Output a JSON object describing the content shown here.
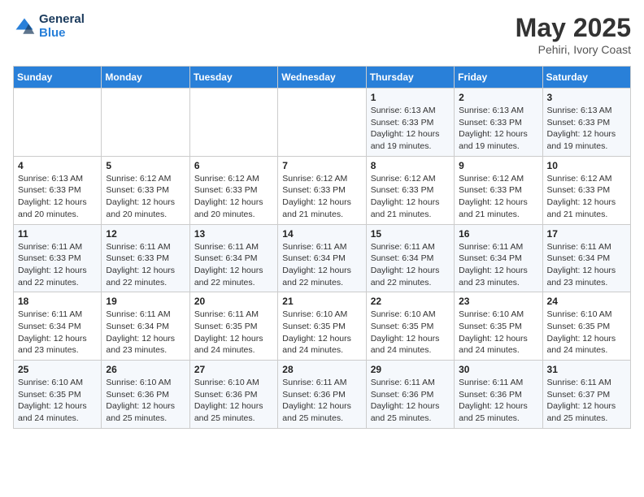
{
  "header": {
    "logo_line1": "General",
    "logo_line2": "Blue",
    "month": "May 2025",
    "location": "Pehiri, Ivory Coast"
  },
  "days_of_week": [
    "Sunday",
    "Monday",
    "Tuesday",
    "Wednesday",
    "Thursday",
    "Friday",
    "Saturday"
  ],
  "weeks": [
    [
      {
        "day": "",
        "info": ""
      },
      {
        "day": "",
        "info": ""
      },
      {
        "day": "",
        "info": ""
      },
      {
        "day": "",
        "info": ""
      },
      {
        "day": "1",
        "info": "Sunrise: 6:13 AM\nSunset: 6:33 PM\nDaylight: 12 hours\nand 19 minutes."
      },
      {
        "day": "2",
        "info": "Sunrise: 6:13 AM\nSunset: 6:33 PM\nDaylight: 12 hours\nand 19 minutes."
      },
      {
        "day": "3",
        "info": "Sunrise: 6:13 AM\nSunset: 6:33 PM\nDaylight: 12 hours\nand 19 minutes."
      }
    ],
    [
      {
        "day": "4",
        "info": "Sunrise: 6:13 AM\nSunset: 6:33 PM\nDaylight: 12 hours\nand 20 minutes."
      },
      {
        "day": "5",
        "info": "Sunrise: 6:12 AM\nSunset: 6:33 PM\nDaylight: 12 hours\nand 20 minutes."
      },
      {
        "day": "6",
        "info": "Sunrise: 6:12 AM\nSunset: 6:33 PM\nDaylight: 12 hours\nand 20 minutes."
      },
      {
        "day": "7",
        "info": "Sunrise: 6:12 AM\nSunset: 6:33 PM\nDaylight: 12 hours\nand 21 minutes."
      },
      {
        "day": "8",
        "info": "Sunrise: 6:12 AM\nSunset: 6:33 PM\nDaylight: 12 hours\nand 21 minutes."
      },
      {
        "day": "9",
        "info": "Sunrise: 6:12 AM\nSunset: 6:33 PM\nDaylight: 12 hours\nand 21 minutes."
      },
      {
        "day": "10",
        "info": "Sunrise: 6:12 AM\nSunset: 6:33 PM\nDaylight: 12 hours\nand 21 minutes."
      }
    ],
    [
      {
        "day": "11",
        "info": "Sunrise: 6:11 AM\nSunset: 6:33 PM\nDaylight: 12 hours\nand 22 minutes."
      },
      {
        "day": "12",
        "info": "Sunrise: 6:11 AM\nSunset: 6:33 PM\nDaylight: 12 hours\nand 22 minutes."
      },
      {
        "day": "13",
        "info": "Sunrise: 6:11 AM\nSunset: 6:34 PM\nDaylight: 12 hours\nand 22 minutes."
      },
      {
        "day": "14",
        "info": "Sunrise: 6:11 AM\nSunset: 6:34 PM\nDaylight: 12 hours\nand 22 minutes."
      },
      {
        "day": "15",
        "info": "Sunrise: 6:11 AM\nSunset: 6:34 PM\nDaylight: 12 hours\nand 22 minutes."
      },
      {
        "day": "16",
        "info": "Sunrise: 6:11 AM\nSunset: 6:34 PM\nDaylight: 12 hours\nand 23 minutes."
      },
      {
        "day": "17",
        "info": "Sunrise: 6:11 AM\nSunset: 6:34 PM\nDaylight: 12 hours\nand 23 minutes."
      }
    ],
    [
      {
        "day": "18",
        "info": "Sunrise: 6:11 AM\nSunset: 6:34 PM\nDaylight: 12 hours\nand 23 minutes."
      },
      {
        "day": "19",
        "info": "Sunrise: 6:11 AM\nSunset: 6:34 PM\nDaylight: 12 hours\nand 23 minutes."
      },
      {
        "day": "20",
        "info": "Sunrise: 6:11 AM\nSunset: 6:35 PM\nDaylight: 12 hours\nand 24 minutes."
      },
      {
        "day": "21",
        "info": "Sunrise: 6:10 AM\nSunset: 6:35 PM\nDaylight: 12 hours\nand 24 minutes."
      },
      {
        "day": "22",
        "info": "Sunrise: 6:10 AM\nSunset: 6:35 PM\nDaylight: 12 hours\nand 24 minutes."
      },
      {
        "day": "23",
        "info": "Sunrise: 6:10 AM\nSunset: 6:35 PM\nDaylight: 12 hours\nand 24 minutes."
      },
      {
        "day": "24",
        "info": "Sunrise: 6:10 AM\nSunset: 6:35 PM\nDaylight: 12 hours\nand 24 minutes."
      }
    ],
    [
      {
        "day": "25",
        "info": "Sunrise: 6:10 AM\nSunset: 6:35 PM\nDaylight: 12 hours\nand 24 minutes."
      },
      {
        "day": "26",
        "info": "Sunrise: 6:10 AM\nSunset: 6:36 PM\nDaylight: 12 hours\nand 25 minutes."
      },
      {
        "day": "27",
        "info": "Sunrise: 6:10 AM\nSunset: 6:36 PM\nDaylight: 12 hours\nand 25 minutes."
      },
      {
        "day": "28",
        "info": "Sunrise: 6:11 AM\nSunset: 6:36 PM\nDaylight: 12 hours\nand 25 minutes."
      },
      {
        "day": "29",
        "info": "Sunrise: 6:11 AM\nSunset: 6:36 PM\nDaylight: 12 hours\nand 25 minutes."
      },
      {
        "day": "30",
        "info": "Sunrise: 6:11 AM\nSunset: 6:36 PM\nDaylight: 12 hours\nand 25 minutes."
      },
      {
        "day": "31",
        "info": "Sunrise: 6:11 AM\nSunset: 6:37 PM\nDaylight: 12 hours\nand 25 minutes."
      }
    ]
  ]
}
